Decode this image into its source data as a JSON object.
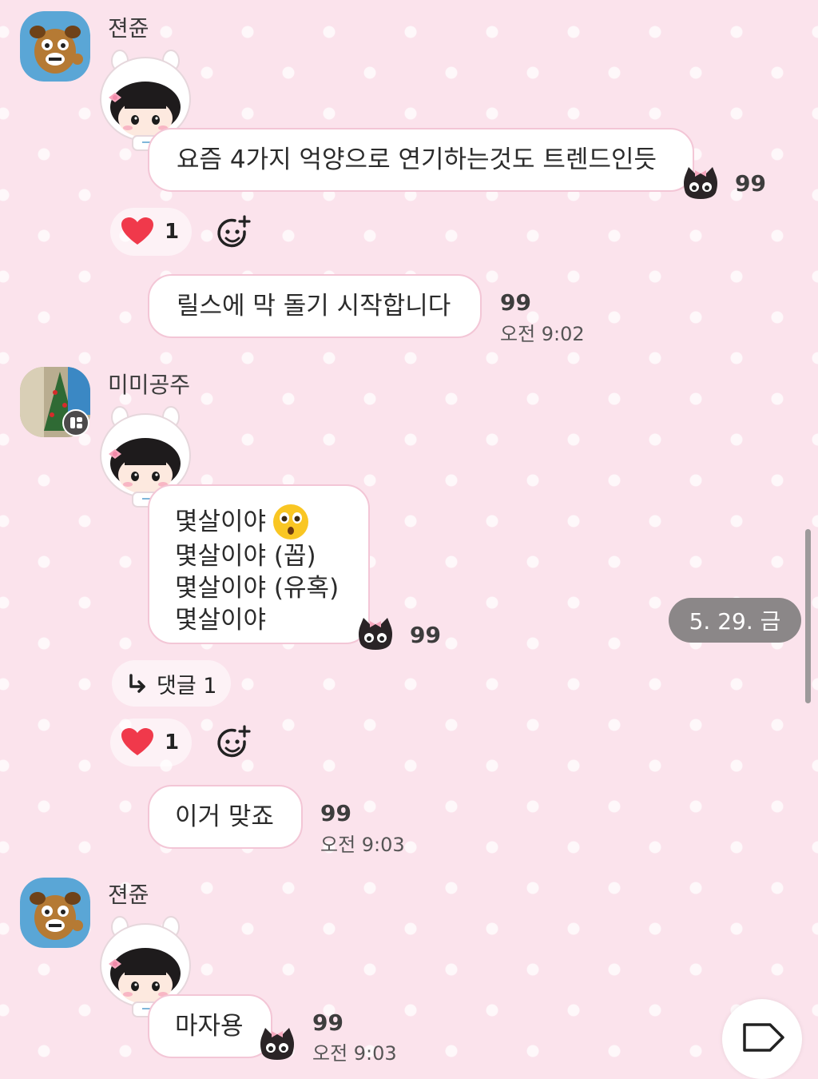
{
  "messages": {
    "g1": {
      "sender": "젼쥰",
      "bubble1": {
        "text": "요즘 4가지 억양으로 연기하는것도 트렌드인듯",
        "read": "99"
      },
      "reaction": {
        "count": "1"
      },
      "bubble2": {
        "text": "릴스에 막 돌기 시작합니다",
        "read": "99",
        "time": "오전 9:02"
      }
    },
    "g2": {
      "sender": "미미공주",
      "bubble1": {
        "lines": [
          "몇살이야",
          "몇살이야 (꼽)",
          "몇살이야 (유혹)",
          "몇살이야"
        ],
        "read": "99"
      },
      "reply": {
        "label": "댓글 1"
      },
      "reaction": {
        "count": "1"
      },
      "bubble2": {
        "text": "이거 맞죠",
        "read": "99",
        "time": "오전 9:03"
      }
    },
    "g3": {
      "sender": "젼쥰",
      "bubble1": {
        "text": "마자용",
        "read": "99",
        "time": "오전 9:03"
      }
    }
  },
  "date_chip": "5. 29. 금",
  "colors": {
    "background": "#fbe3ec",
    "bubble_border": "#f3c6d6",
    "heart": "#f0394b",
    "date_chip": "#8b8788"
  },
  "icons": [
    "heart-icon",
    "add-emoji-icon",
    "reply-arrow-icon",
    "cat-sticker-icon",
    "tag-icon",
    "astonished-emoji-icon"
  ]
}
